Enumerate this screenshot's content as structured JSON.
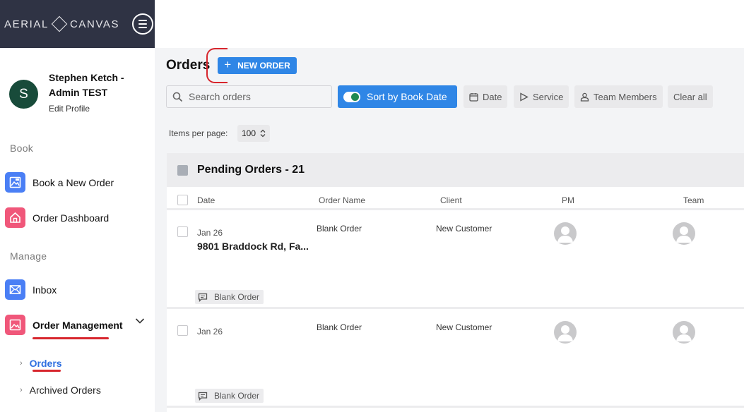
{
  "brand": {
    "logo_left": "AERIAL",
    "logo_right": "CANVAS"
  },
  "profile": {
    "initial": "S",
    "name": "Stephen Ketch - Admin TEST",
    "edit_label": "Edit Profile"
  },
  "sidebar": {
    "book_section": "Book",
    "manage_section": "Manage",
    "items": [
      {
        "label": "Book a New Order",
        "icon": "book-order-icon"
      },
      {
        "label": "Order Dashboard",
        "icon": "home-icon"
      },
      {
        "label": "Inbox",
        "icon": "mail-icon"
      },
      {
        "label": "Order Management",
        "icon": "order-management-icon"
      }
    ],
    "sub_items": [
      {
        "label": "Orders",
        "active": true
      },
      {
        "label": "Archived Orders",
        "active": false
      }
    ]
  },
  "main": {
    "title": "Orders",
    "new_order_label": "NEW ORDER",
    "search_placeholder": "Search orders",
    "sort_label": "Sort by Book Date",
    "filters": {
      "date": "Date",
      "service": "Service",
      "team": "Team Members",
      "clear": "Clear all"
    },
    "items_per_page_label": "Items per page:",
    "items_per_page_value": "100",
    "group_title": "Pending Orders - 21",
    "columns": [
      "Date",
      "Order Name",
      "Client",
      "PM",
      "Team"
    ],
    "rows": [
      {
        "date": "Jan 26",
        "address": "9801 Braddock Rd, Fa...",
        "order_name": "Blank Order",
        "client": "New Customer",
        "tag": "Blank Order"
      },
      {
        "date": "Jan 26",
        "address": "",
        "order_name": "Blank Order",
        "client": "New Customer",
        "tag": "Blank Order"
      }
    ]
  },
  "colors": {
    "sidebar_brand": "#2f3344",
    "primary": "#2f86e6",
    "avatar": "#184b3a",
    "accent_red": "#d7262d",
    "nav_blue": "#4a7ff5",
    "nav_pink": "#f0577a"
  }
}
